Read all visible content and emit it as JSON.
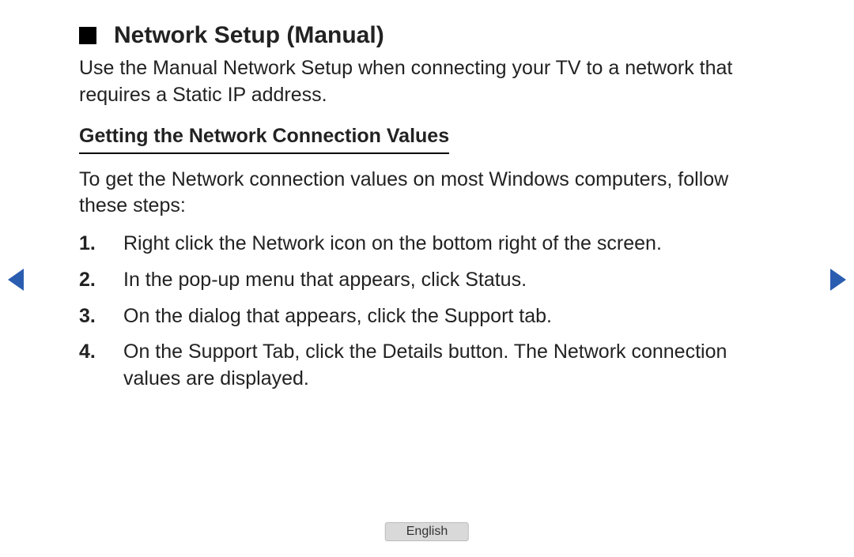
{
  "header": {
    "title": "Network Setup (Manual)"
  },
  "intro": "Use the Manual Network Setup when connecting your TV to a network that requires a Static IP address.",
  "subheading": "Getting the Network Connection Values",
  "lead": "To get the Network connection values on most Windows computers, follow these steps:",
  "steps": [
    {
      "num": "1.",
      "text": "Right click the Network icon on the bottom right of the screen."
    },
    {
      "num": "2.",
      "text": "In the pop-up menu that appears, click Status."
    },
    {
      "num": "3.",
      "text": "On the dialog that appears, click the Support tab."
    },
    {
      "num": "4.",
      "text": "On the Support Tab, click the Details button. The Network connection values are displayed."
    }
  ],
  "footer": {
    "language": "English"
  }
}
